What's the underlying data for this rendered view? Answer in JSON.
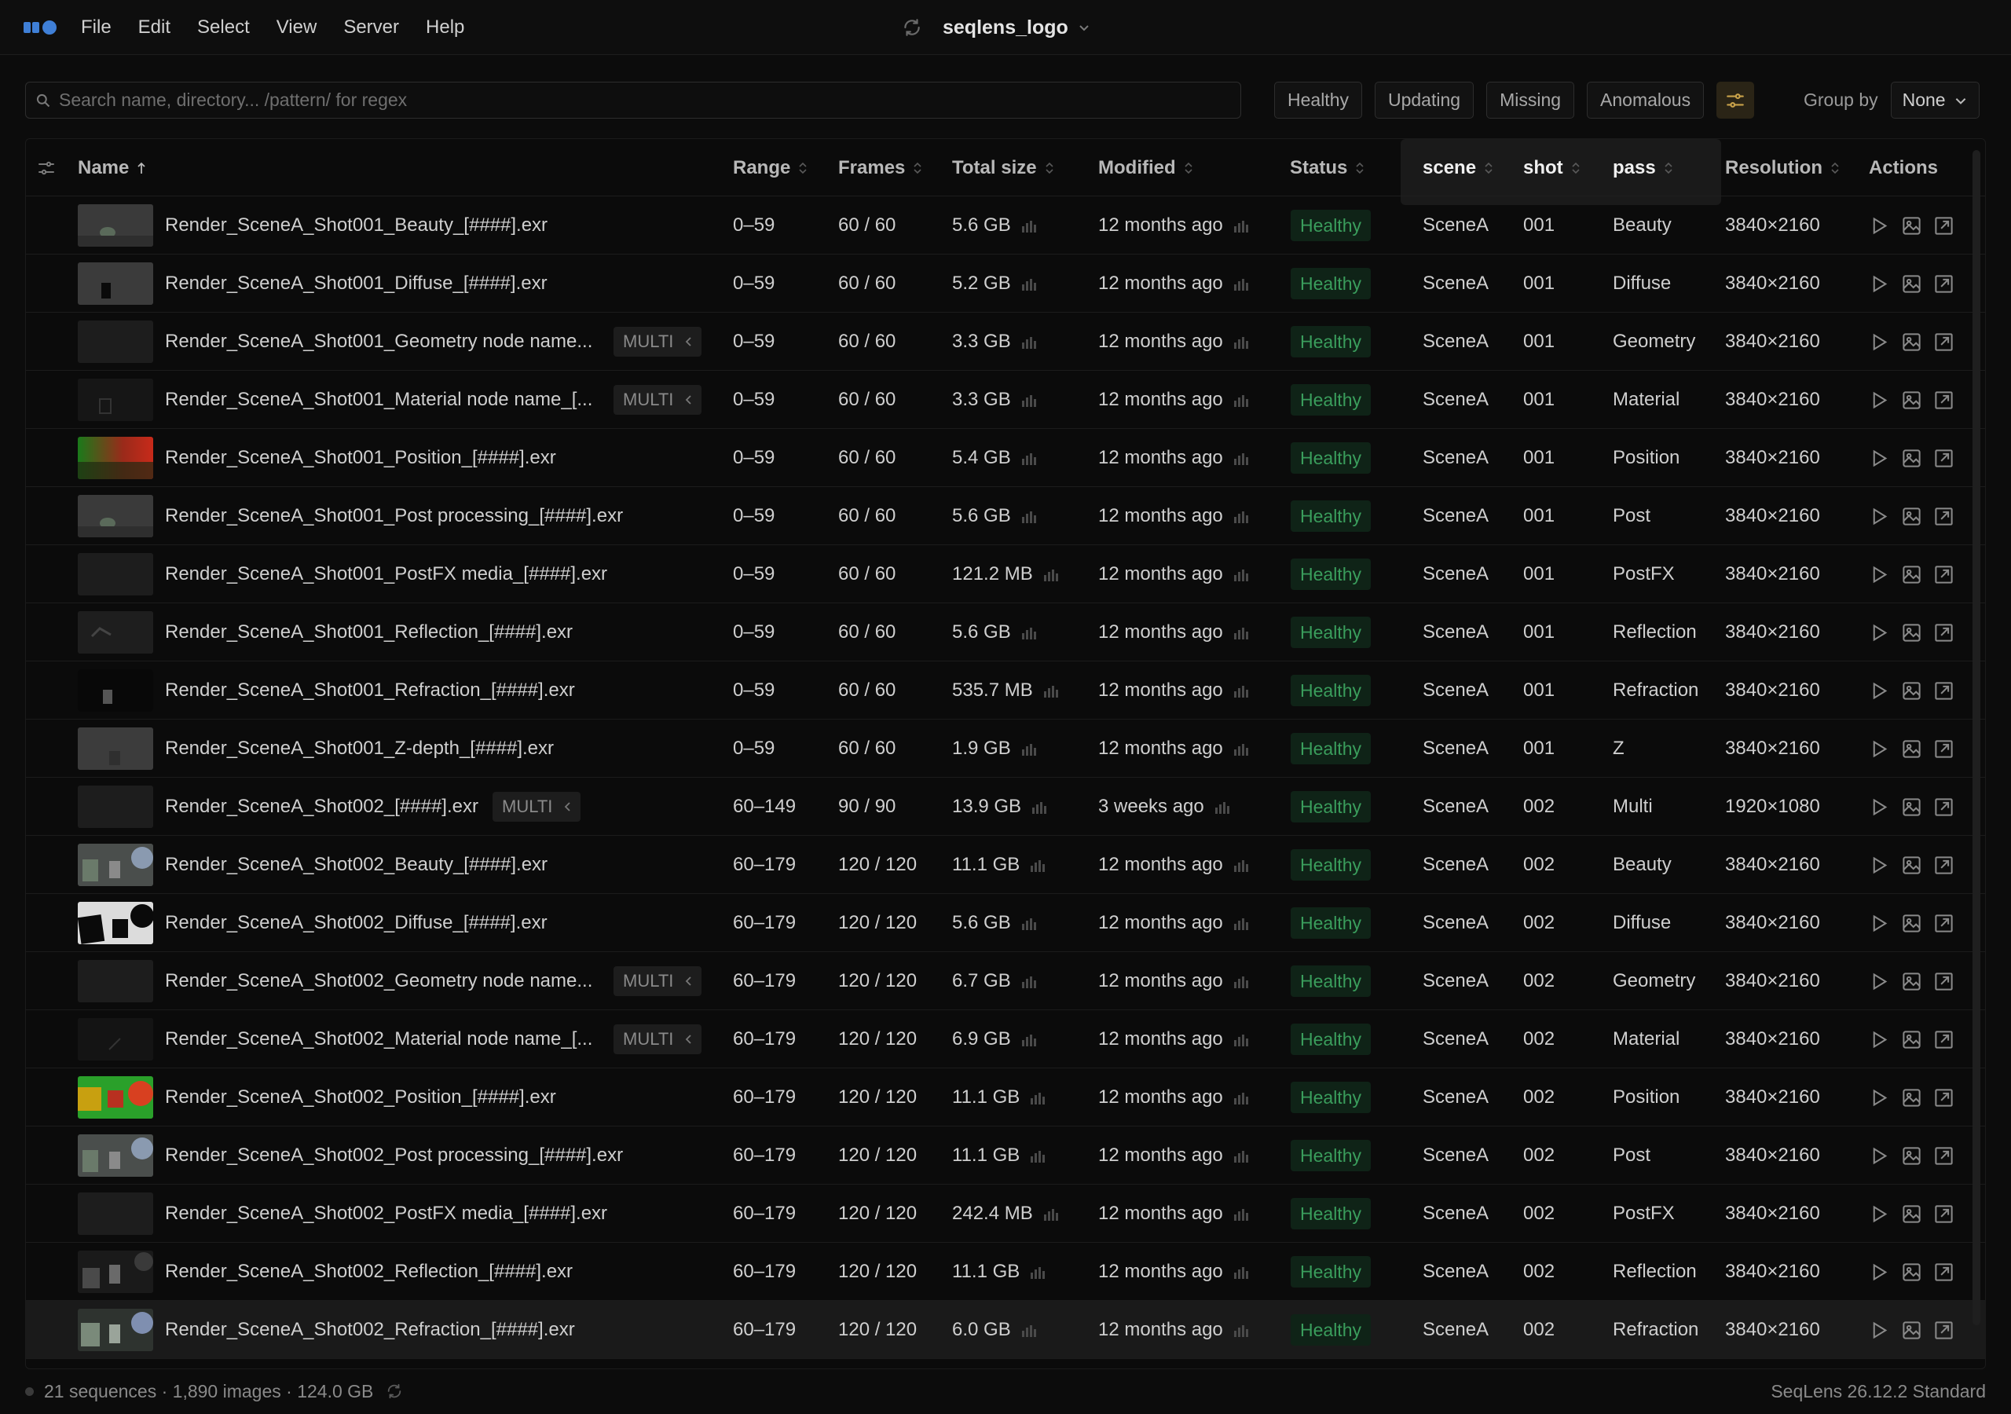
{
  "menubar": {
    "items": [
      "File",
      "Edit",
      "Select",
      "View",
      "Server",
      "Help"
    ],
    "title": "seqlens_logo"
  },
  "toolbar": {
    "search_placeholder": "Search name, directory... /pattern/ for regex",
    "filters": [
      "Healthy",
      "Updating",
      "Missing",
      "Anomalous"
    ],
    "group_by_label": "Group by",
    "group_by_value": "None"
  },
  "colors": {
    "healthy": "#3a9d5c",
    "accent": "#c9a24a",
    "logo": "#3f7fd6"
  },
  "table": {
    "columns": [
      "Name",
      "Range",
      "Frames",
      "Total size",
      "Modified",
      "Status",
      "scene",
      "shot",
      "pass",
      "Resolution",
      "Actions"
    ],
    "sort_column": "Name",
    "sort_direction": "ascending",
    "rows": [
      {
        "name": "Render_SceneA_Shot001_Beauty_[####].exr",
        "multi": false,
        "range": "0–59",
        "frames": "60 / 60",
        "size": "5.6 GB",
        "modified": "12 months ago",
        "status": "Healthy",
        "scene": "SceneA",
        "shot": "001",
        "pass": "Beauty",
        "resolution": "3840×2160",
        "thumb": "beauty1"
      },
      {
        "name": "Render_SceneA_Shot001_Diffuse_[####].exr",
        "multi": false,
        "range": "0–59",
        "frames": "60 / 60",
        "size": "5.2 GB",
        "modified": "12 months ago",
        "status": "Healthy",
        "scene": "SceneA",
        "shot": "001",
        "pass": "Diffuse",
        "resolution": "3840×2160",
        "thumb": "diffuse1"
      },
      {
        "name": "Render_SceneA_Shot001_Geometry node name...",
        "multi": true,
        "range": "0–59",
        "frames": "60 / 60",
        "size": "3.3 GB",
        "modified": "12 months ago",
        "status": "Healthy",
        "scene": "SceneA",
        "shot": "001",
        "pass": "Geometry",
        "resolution": "3840×2160",
        "thumb": "dark"
      },
      {
        "name": "Render_SceneA_Shot001_Material node name_[...",
        "multi": true,
        "range": "0–59",
        "frames": "60 / 60",
        "size": "3.3 GB",
        "modified": "12 months ago",
        "status": "Healthy",
        "scene": "SceneA",
        "shot": "001",
        "pass": "Material",
        "resolution": "3840×2160",
        "thumb": "material1"
      },
      {
        "name": "Render_SceneA_Shot001_Position_[####].exr",
        "multi": false,
        "range": "0–59",
        "frames": "60 / 60",
        "size": "5.4 GB",
        "modified": "12 months ago",
        "status": "Healthy",
        "scene": "SceneA",
        "shot": "001",
        "pass": "Position",
        "resolution": "3840×2160",
        "thumb": "position1"
      },
      {
        "name": "Render_SceneA_Shot001_Post processing_[####].exr",
        "multi": false,
        "range": "0–59",
        "frames": "60 / 60",
        "size": "5.6 GB",
        "modified": "12 months ago",
        "status": "Healthy",
        "scene": "SceneA",
        "shot": "001",
        "pass": "Post",
        "resolution": "3840×2160",
        "thumb": "beauty1"
      },
      {
        "name": "Render_SceneA_Shot001_PostFX media_[####].exr",
        "multi": false,
        "range": "0–59",
        "frames": "60 / 60",
        "size": "121.2 MB",
        "modified": "12 months ago",
        "status": "Healthy",
        "scene": "SceneA",
        "shot": "001",
        "pass": "PostFX",
        "resolution": "3840×2160",
        "thumb": "dark"
      },
      {
        "name": "Render_SceneA_Shot001_Reflection_[####].exr",
        "multi": false,
        "range": "0–59",
        "frames": "60 / 60",
        "size": "5.6 GB",
        "modified": "12 months ago",
        "status": "Healthy",
        "scene": "SceneA",
        "shot": "001",
        "pass": "Reflection",
        "resolution": "3840×2160",
        "thumb": "reflection1"
      },
      {
        "name": "Render_SceneA_Shot001_Refraction_[####].exr",
        "multi": false,
        "range": "0–59",
        "frames": "60 / 60",
        "size": "535.7 MB",
        "modified": "12 months ago",
        "status": "Healthy",
        "scene": "SceneA",
        "shot": "001",
        "pass": "Refraction",
        "resolution": "3840×2160",
        "thumb": "refraction1"
      },
      {
        "name": "Render_SceneA_Shot001_Z-depth_[####].exr",
        "multi": false,
        "range": "0–59",
        "frames": "60 / 60",
        "size": "1.9 GB",
        "modified": "12 months ago",
        "status": "Healthy",
        "scene": "SceneA",
        "shot": "001",
        "pass": "Z",
        "resolution": "3840×2160",
        "thumb": "zdepth1"
      },
      {
        "name": "Render_SceneA_Shot002_[####].exr",
        "multi": true,
        "range": "60–149",
        "frames": "90 / 90",
        "size": "13.9 GB",
        "modified": "3 weeks ago",
        "status": "Healthy",
        "scene": "SceneA",
        "shot": "002",
        "pass": "Multi",
        "resolution": "1920×1080",
        "thumb": "dark"
      },
      {
        "name": "Render_SceneA_Shot002_Beauty_[####].exr",
        "multi": false,
        "range": "60–179",
        "frames": "120 / 120",
        "size": "11.1 GB",
        "modified": "12 months ago",
        "status": "Healthy",
        "scene": "SceneA",
        "shot": "002",
        "pass": "Beauty",
        "resolution": "3840×2160",
        "thumb": "beauty2"
      },
      {
        "name": "Render_SceneA_Shot002_Diffuse_[####].exr",
        "multi": false,
        "range": "60–179",
        "frames": "120 / 120",
        "size": "5.6 GB",
        "modified": "12 months ago",
        "status": "Healthy",
        "scene": "SceneA",
        "shot": "002",
        "pass": "Diffuse",
        "resolution": "3840×2160",
        "thumb": "diffuse2"
      },
      {
        "name": "Render_SceneA_Shot002_Geometry node name...",
        "multi": true,
        "range": "60–179",
        "frames": "120 / 120",
        "size": "6.7 GB",
        "modified": "12 months ago",
        "status": "Healthy",
        "scene": "SceneA",
        "shot": "002",
        "pass": "Geometry",
        "resolution": "3840×2160",
        "thumb": "dark"
      },
      {
        "name": "Render_SceneA_Shot002_Material node name_[...",
        "multi": true,
        "range": "60–179",
        "frames": "120 / 120",
        "size": "6.9 GB",
        "modified": "12 months ago",
        "status": "Healthy",
        "scene": "SceneA",
        "shot": "002",
        "pass": "Material",
        "resolution": "3840×2160",
        "thumb": "material2"
      },
      {
        "name": "Render_SceneA_Shot002_Position_[####].exr",
        "multi": false,
        "range": "60–179",
        "frames": "120 / 120",
        "size": "11.1 GB",
        "modified": "12 months ago",
        "status": "Healthy",
        "scene": "SceneA",
        "shot": "002",
        "pass": "Position",
        "resolution": "3840×2160",
        "thumb": "position2"
      },
      {
        "name": "Render_SceneA_Shot002_Post processing_[####].exr",
        "multi": false,
        "range": "60–179",
        "frames": "120 / 120",
        "size": "11.1 GB",
        "modified": "12 months ago",
        "status": "Healthy",
        "scene": "SceneA",
        "shot": "002",
        "pass": "Post",
        "resolution": "3840×2160",
        "thumb": "beauty2"
      },
      {
        "name": "Render_SceneA_Shot002_PostFX media_[####].exr",
        "multi": false,
        "range": "60–179",
        "frames": "120 / 120",
        "size": "242.4 MB",
        "modified": "12 months ago",
        "status": "Healthy",
        "scene": "SceneA",
        "shot": "002",
        "pass": "PostFX",
        "resolution": "3840×2160",
        "thumb": "dark"
      },
      {
        "name": "Render_SceneA_Shot002_Reflection_[####].exr",
        "multi": false,
        "range": "60–179",
        "frames": "120 / 120",
        "size": "11.1 GB",
        "modified": "12 months ago",
        "status": "Healthy",
        "scene": "SceneA",
        "shot": "002",
        "pass": "Reflection",
        "resolution": "3840×2160",
        "thumb": "reflection2"
      },
      {
        "name": "Render_SceneA_Shot002_Refraction_[####].exr",
        "multi": false,
        "range": "60–179",
        "frames": "120 / 120",
        "size": "6.0 GB",
        "modified": "12 months ago",
        "status": "Healthy",
        "scene": "SceneA",
        "shot": "002",
        "pass": "Refraction",
        "resolution": "3840×2160",
        "thumb": "refraction2",
        "selected": true
      }
    ],
    "multi_label": "MULTI"
  },
  "statusbar": {
    "summary": "21 sequences · 1,890 images · 124.0 GB",
    "version": "SeqLens 26.12.2 Standard"
  }
}
